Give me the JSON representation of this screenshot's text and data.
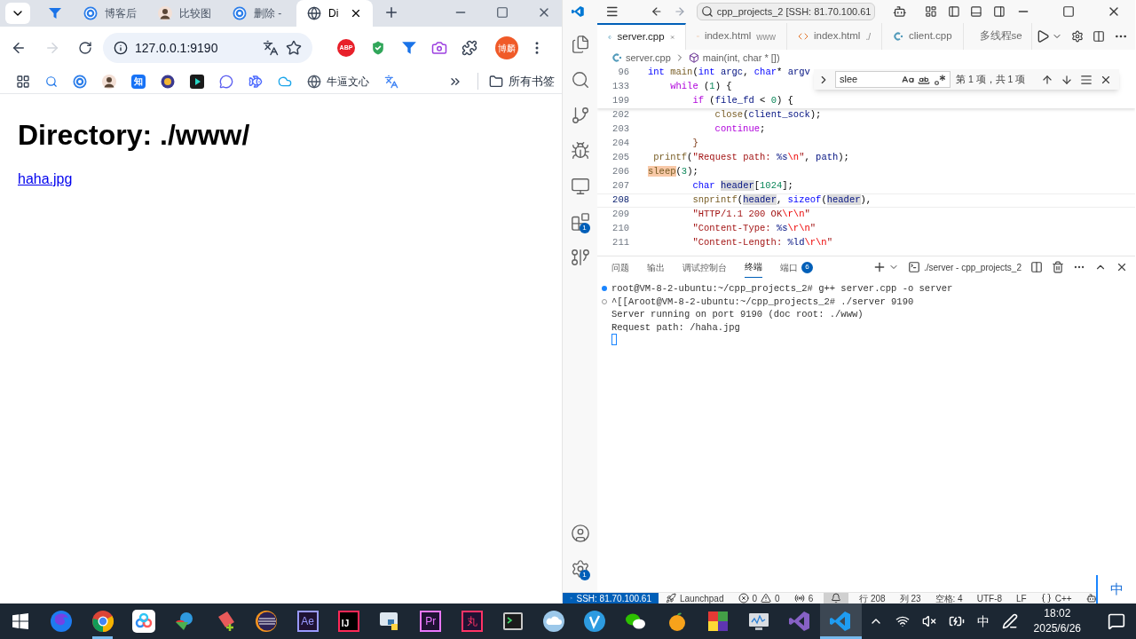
{
  "browser": {
    "tabs": [
      {
        "kind": "funnel",
        "selected": false
      },
      {
        "kind": "blog",
        "title": "博客后",
        "selected": false
      },
      {
        "kind": "avatar",
        "title": "比较图",
        "selected": false
      },
      {
        "kind": "blog",
        "title": "删除 -",
        "selected": false
      },
      {
        "kind": "globe",
        "title": "Di",
        "selected": true
      }
    ],
    "back": {
      "disabled": false
    },
    "forward": {
      "disabled": true
    },
    "address": "127.0.0.1:9190",
    "extensions": [
      {
        "kind": "abp",
        "label": "ABP"
      },
      {
        "kind": "shield"
      },
      {
        "kind": "funnel"
      },
      {
        "kind": "camera"
      },
      {
        "kind": "puzzle"
      }
    ],
    "profile": "博麟",
    "bookmarks": [
      {
        "kind": "apps"
      },
      {
        "kind": "search"
      },
      {
        "kind": "blog"
      },
      {
        "kind": "avatar"
      },
      {
        "kind": "zhihu",
        "label": "知"
      },
      {
        "kind": "badge"
      },
      {
        "kind": "play"
      },
      {
        "kind": "chat"
      },
      {
        "kind": "whale"
      },
      {
        "kind": "cloud"
      },
      {
        "kind": "globe",
        "label": "牛逼文心"
      },
      {
        "kind": "translate"
      }
    ],
    "all_bookmarks": "所有书签",
    "page": {
      "heading": "Directory: ./www/",
      "links": [
        "haha.jpg"
      ]
    }
  },
  "editor": {
    "title_search": "cpp_projects_2 [SSH: 81.70.100.61",
    "tabs": [
      {
        "kind": "cpp",
        "label": "server.cpp",
        "selected": true
      },
      {
        "kind": "html",
        "label": "index.html",
        "detail": "www",
        "selected": false
      },
      {
        "kind": "html",
        "label": "index.html",
        "detail": "./",
        "selected": false
      },
      {
        "kind": "cpp",
        "label": "client.cpp",
        "selected": false
      },
      {
        "kind": "cpp",
        "label": "多线程se",
        "selected": false
      }
    ],
    "breadcrumb": {
      "file": "server.cpp",
      "symbol": "main(int, char * [])"
    },
    "activity": [
      {
        "kind": "files"
      },
      {
        "kind": "search"
      },
      {
        "kind": "scm"
      },
      {
        "kind": "debug"
      },
      {
        "kind": "remote"
      },
      {
        "kind": "extensions",
        "badge": "1"
      },
      {
        "kind": "gitgraph"
      }
    ],
    "activity_bottom": [
      {
        "kind": "account"
      },
      {
        "kind": "manage",
        "badge": "1"
      }
    ],
    "sticky_lines": [
      {
        "number": "96",
        "tokens": [
          {
            "t": "int ",
            "kind": "kw"
          },
          {
            "t": "main",
            "kind": "fn"
          },
          {
            "t": "(",
            "kind": "p"
          },
          {
            "t": "int ",
            "kind": "kw"
          },
          {
            "t": "argc",
            "kind": "var"
          },
          {
            "t": ", ",
            "kind": "p"
          },
          {
            "t": "char",
            "kind": "kw"
          },
          {
            "t": "* ",
            "kind": "p"
          },
          {
            "t": "argv",
            "kind": "var"
          }
        ]
      },
      {
        "number": "133",
        "tokens": [
          {
            "t": "    while",
            "kind": "ctrl"
          },
          {
            "t": " (",
            "kind": "p"
          },
          {
            "t": "1",
            "kind": "num"
          },
          {
            "t": ") {",
            "kind": "p"
          }
        ]
      },
      {
        "number": "199",
        "tokens": [
          {
            "t": "        if",
            "kind": "ctrl"
          },
          {
            "t": " (",
            "kind": "p"
          },
          {
            "t": "file_fd",
            "kind": "var"
          },
          {
            "t": " < ",
            "kind": "p"
          },
          {
            "t": "0",
            "kind": "num"
          },
          {
            "t": ") {",
            "kind": "p"
          }
        ]
      }
    ],
    "lines": [
      {
        "number": "202",
        "current": false,
        "tokens": [
          {
            "t": "            close",
            "kind": "fn"
          },
          {
            "t": "(",
            "kind": "p"
          },
          {
            "t": "client_sock",
            "kind": "var"
          },
          {
            "t": ");",
            "kind": "p"
          }
        ]
      },
      {
        "number": "203",
        "current": false,
        "tokens": [
          {
            "t": "            continue",
            "kind": "ctrl"
          },
          {
            "t": ";",
            "kind": "p"
          }
        ]
      },
      {
        "number": "204",
        "current": false,
        "tokens": [
          {
            "t": "        }",
            "kind": "br"
          }
        ]
      },
      {
        "number": "205",
        "current": false,
        "tokens": [
          {
            "t": " printf",
            "kind": "fn"
          },
          {
            "t": "(",
            "kind": "p"
          },
          {
            "t": "\"Request path: ",
            "kind": "str"
          },
          {
            "t": "%s",
            "kind": "fmt"
          },
          {
            "t": "\\n",
            "kind": "esc"
          },
          {
            "t": "\"",
            "kind": "str"
          },
          {
            "t": ", ",
            "kind": "p"
          },
          {
            "t": "path",
            "kind": "var"
          },
          {
            "t": ");",
            "kind": "p"
          }
        ]
      },
      {
        "number": "206",
        "current": false,
        "tokens": [
          {
            "t": "sleep",
            "kind": "fnmatch"
          },
          {
            "t": "(",
            "kind": "p"
          },
          {
            "t": "3",
            "kind": "num"
          },
          {
            "t": ");",
            "kind": "p"
          }
        ]
      },
      {
        "number": "207",
        "current": false,
        "tokens": [
          {
            "t": "        char ",
            "kind": "kw"
          },
          {
            "t": "header",
            "kind": "varref"
          },
          {
            "t": "[",
            "kind": "p"
          },
          {
            "t": "1024",
            "kind": "num"
          },
          {
            "t": "];",
            "kind": "p"
          }
        ]
      },
      {
        "number": "208",
        "current": true,
        "tokens": [
          {
            "t": "        snprintf",
            "kind": "fn"
          },
          {
            "t": "(",
            "kind": "p"
          },
          {
            "t": "header",
            "kind": "varref"
          },
          {
            "t": ", ",
            "kind": "p"
          },
          {
            "t": "sizeof",
            "kind": "kw"
          },
          {
            "t": "(",
            "kind": "p"
          },
          {
            "t": "header",
            "kind": "varref"
          },
          {
            "t": "),",
            "kind": "p"
          }
        ]
      },
      {
        "number": "209",
        "current": false,
        "tokens": [
          {
            "t": "        \"HTTP/1.1 200 OK",
            "kind": "str"
          },
          {
            "t": "\\r\\n",
            "kind": "esc"
          },
          {
            "t": "\"",
            "kind": "str"
          }
        ]
      },
      {
        "number": "210",
        "current": false,
        "tokens": [
          {
            "t": "        \"Content-Type: ",
            "kind": "str"
          },
          {
            "t": "%s",
            "kind": "fmt"
          },
          {
            "t": "\\r\\n",
            "kind": "esc"
          },
          {
            "t": "\"",
            "kind": "str"
          }
        ]
      },
      {
        "number": "211",
        "current": false,
        "tokens": [
          {
            "t": "        \"Content-Length: ",
            "kind": "str"
          },
          {
            "t": "%ld",
            "kind": "fmt"
          },
          {
            "t": "\\r\\n",
            "kind": "esc"
          },
          {
            "t": "\"",
            "kind": "str"
          }
        ]
      }
    ],
    "find": {
      "query": "slee",
      "result": "第 1 项，共 1 项"
    },
    "panel": {
      "tabs": [
        {
          "label": "问题",
          "selected": false
        },
        {
          "label": "输出",
          "selected": false
        },
        {
          "label": "调试控制台",
          "selected": false
        },
        {
          "label": "终端",
          "selected": true
        },
        {
          "label": "端口",
          "badge": "6",
          "selected": false
        }
      ],
      "terminal_name": "./server - cpp_projects_2",
      "lines": [
        {
          "kind": "success",
          "text": "root@VM-8-2-ubuntu:~/cpp_projects_2# g++ server.cpp -o server"
        },
        {
          "kind": "neutral",
          "text": "^[[Aroot@VM-8-2-ubuntu:~/cpp_projects_2# ./server 9190"
        },
        {
          "kind": "output",
          "text": "Server running on port 9190 (doc root: ./www)"
        },
        {
          "kind": "output",
          "text": "Request path: /haha.jpg"
        }
      ]
    },
    "status": [
      {
        "kind": "remote",
        "text": "SSH: 81.70.100.61"
      },
      {
        "kind": "launchpad",
        "text": "Launchpad"
      },
      {
        "kind": "problems",
        "errors": "0",
        "warnings": "0"
      },
      {
        "kind": "ports",
        "text": "6"
      },
      {
        "kind": "notify"
      },
      {
        "kind": "text",
        "text": "行 208"
      },
      {
        "kind": "text",
        "text": "列 23"
      },
      {
        "kind": "text",
        "text": "空格: 4"
      },
      {
        "kind": "text",
        "text": "UTF-8"
      },
      {
        "kind": "text",
        "text": "LF"
      },
      {
        "kind": "lang",
        "text": "C++"
      },
      {
        "kind": "copilot"
      }
    ],
    "ime": "中"
  },
  "taskbar": {
    "apps": [
      {
        "kind": "start",
        "open": false,
        "selected": false
      },
      {
        "kind": "firefox",
        "open": false,
        "selected": false
      },
      {
        "kind": "chrome",
        "open": true,
        "selected": false
      },
      {
        "kind": "netdisk",
        "open": false,
        "selected": false
      },
      {
        "kind": "idm",
        "open": false,
        "selected": false
      },
      {
        "kind": "notepad",
        "open": false,
        "selected": false
      },
      {
        "kind": "eclipse",
        "open": false,
        "selected": false
      },
      {
        "kind": "lettered",
        "label": "Ae",
        "color": "#9999ff",
        "open": false,
        "selected": false
      },
      {
        "kind": "jetbrains",
        "label": "IJ",
        "open": false,
        "selected": false
      },
      {
        "kind": "python",
        "open": false,
        "selected": false
      },
      {
        "kind": "lettered",
        "label": "Pr",
        "color": "#ea77ff",
        "open": false,
        "selected": false
      },
      {
        "kind": "lettered",
        "label": "丸",
        "color": "#ff3366",
        "open": false,
        "selected": false
      },
      {
        "kind": "terminal",
        "open": false,
        "selected": false
      },
      {
        "kind": "cloud",
        "open": false,
        "selected": false
      },
      {
        "kind": "vcheck",
        "open": false,
        "selected": false
      },
      {
        "kind": "wechat",
        "open": false,
        "selected": false
      },
      {
        "kind": "orange",
        "open": false,
        "selected": false
      },
      {
        "kind": "blocks",
        "open": false,
        "selected": false
      },
      {
        "kind": "monitor",
        "open": false,
        "selected": false
      },
      {
        "kind": "vs",
        "open": false,
        "selected": false
      },
      {
        "kind": "vscode",
        "open": true,
        "selected": true
      }
    ],
    "ime": "中",
    "time": "18:02",
    "date": "2025/6/26"
  }
}
